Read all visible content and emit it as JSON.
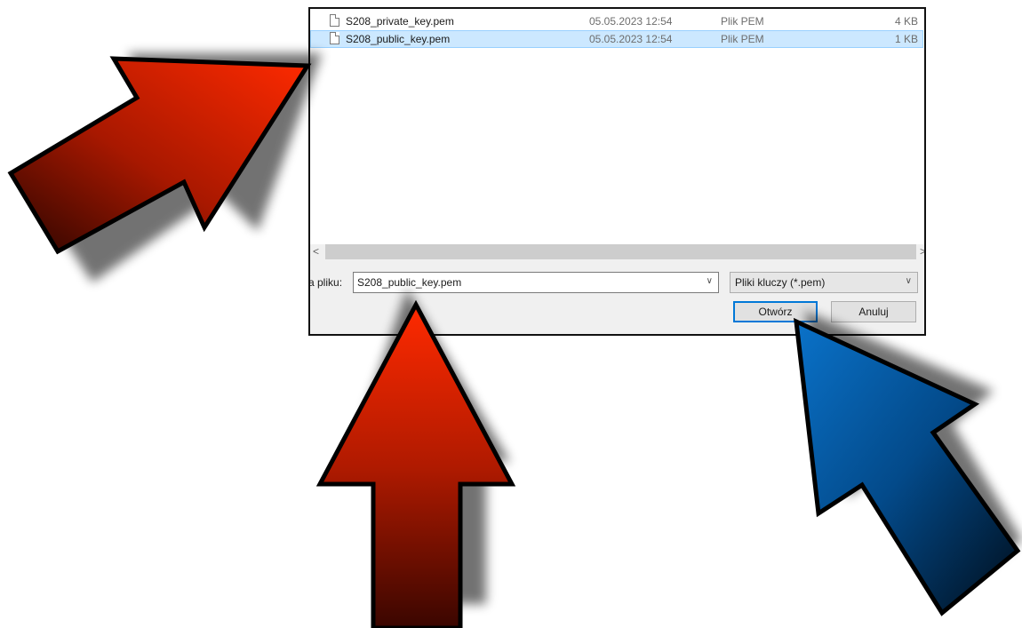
{
  "files": [
    {
      "name": "S208_private_key.pem",
      "date": "05.05.2023 12:54",
      "type": "Plik PEM",
      "size": "4 KB",
      "selected": false
    },
    {
      "name": "S208_public_key.pem",
      "date": "05.05.2023 12:54",
      "type": "Plik PEM",
      "size": "1 KB",
      "selected": true
    }
  ],
  "scroll": {
    "left_arrow": "<",
    "right_arrow": ">"
  },
  "filename": {
    "label": "a pliku:",
    "value": "S208_public_key.pem"
  },
  "filter": {
    "value": "Pliki kluczy (*.pem)"
  },
  "buttons": {
    "open": "Otwórz",
    "cancel": "Anuluj"
  },
  "arrows": [
    {
      "id": "arrow-red-diagonal",
      "color": "#ff2a00",
      "points_to": "file-list"
    },
    {
      "id": "arrow-red-up",
      "color": "#ff2a00",
      "points_to": "filename-input"
    },
    {
      "id": "arrow-blue-diagonal",
      "color": "#0a72c9",
      "points_to": "open-button"
    }
  ],
  "colors": {
    "selection": "#cce8ff",
    "accent": "#0078d7"
  }
}
